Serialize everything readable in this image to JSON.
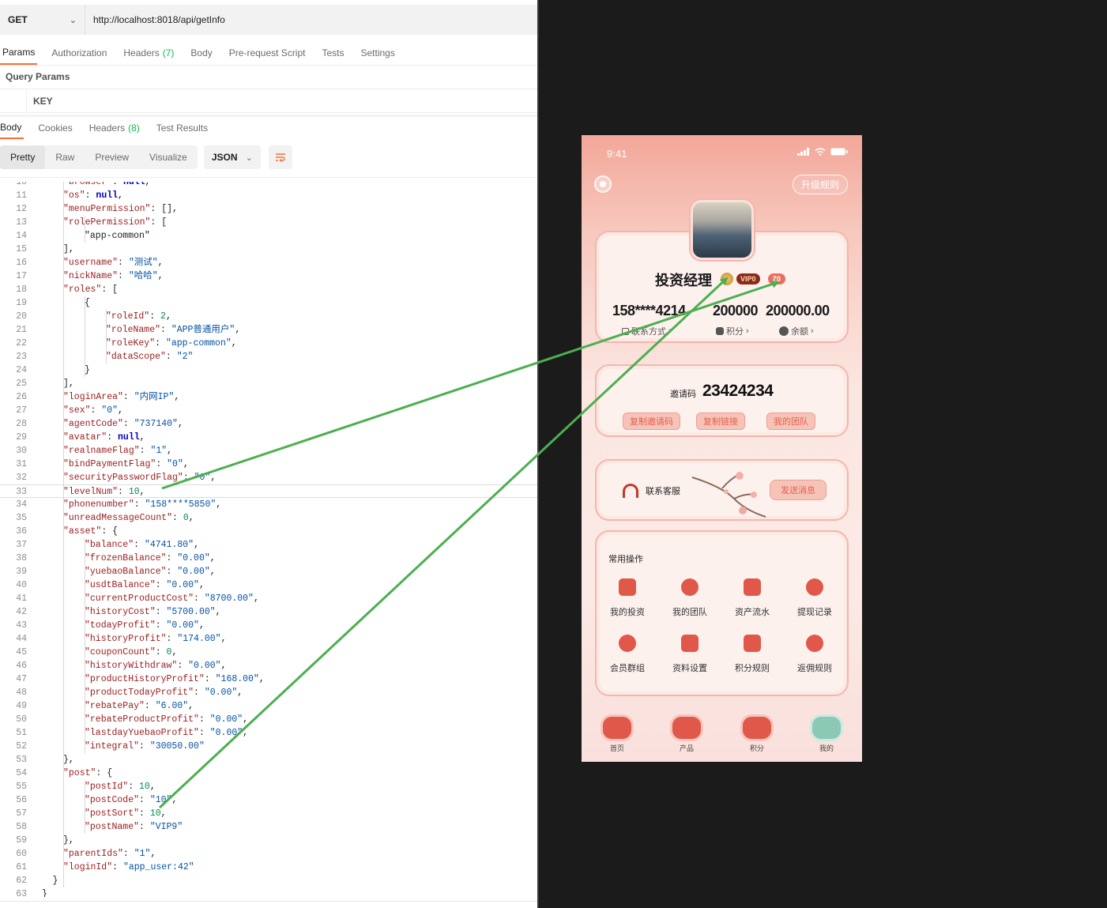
{
  "request": {
    "method": "GET",
    "url": "http://localhost:8018/api/getInfo",
    "tabs": [
      {
        "label": "Params",
        "active": true
      },
      {
        "label": "Authorization"
      },
      {
        "label": "Headers",
        "count": "(7)"
      },
      {
        "label": "Body"
      },
      {
        "label": "Pre-request Script"
      },
      {
        "label": "Tests"
      },
      {
        "label": "Settings"
      }
    ],
    "query_params_title": "Query Params",
    "key_header": "KEY"
  },
  "response": {
    "tabs": [
      {
        "label": "Body",
        "active": true
      },
      {
        "label": "Cookies"
      },
      {
        "label": "Headers",
        "count": "(8)"
      },
      {
        "label": "Test Results"
      }
    ],
    "formats": [
      "Pretty",
      "Raw",
      "Preview",
      "Visualize"
    ],
    "active_format": "Pretty",
    "language": "JSON"
  },
  "code_lines": [
    {
      "n": "10",
      "t": "\"browser\": null,",
      "i": 1,
      "cut": true
    },
    {
      "n": "11",
      "t": "\"os\": null,",
      "i": 1
    },
    {
      "n": "12",
      "t": "\"menuPermission\": [],",
      "i": 1
    },
    {
      "n": "13",
      "t": "\"rolePermission\": [",
      "i": 1
    },
    {
      "n": "14",
      "t": "\"app-common\"",
      "i": 2
    },
    {
      "n": "15",
      "t": "],",
      "i": 1
    },
    {
      "n": "16",
      "t": "\"username\": \"测试\",",
      "i": 1
    },
    {
      "n": "17",
      "t": "\"nickName\": \"哈哈\",",
      "i": 1
    },
    {
      "n": "18",
      "t": "\"roles\": [",
      "i": 1
    },
    {
      "n": "19",
      "t": "{",
      "i": 2
    },
    {
      "n": "20",
      "t": "\"roleId\": 2,",
      "i": 3
    },
    {
      "n": "21",
      "t": "\"roleName\": \"APP普通用户\",",
      "i": 3
    },
    {
      "n": "22",
      "t": "\"roleKey\": \"app-common\",",
      "i": 3
    },
    {
      "n": "23",
      "t": "\"dataScope\": \"2\"",
      "i": 3
    },
    {
      "n": "24",
      "t": "}",
      "i": 2
    },
    {
      "n": "25",
      "t": "],",
      "i": 1
    },
    {
      "n": "26",
      "t": "\"loginArea\": \"内网IP\",",
      "i": 1
    },
    {
      "n": "27",
      "t": "\"sex\": \"0\",",
      "i": 1
    },
    {
      "n": "28",
      "t": "\"agentCode\": \"737140\",",
      "i": 1
    },
    {
      "n": "29",
      "t": "\"avatar\": null,",
      "i": 1
    },
    {
      "n": "30",
      "t": "\"realnameFlag\": \"1\",",
      "i": 1
    },
    {
      "n": "31",
      "t": "\"bindPaymentFlag\": \"0\",",
      "i": 1
    },
    {
      "n": "32",
      "t": "\"securityPasswordFlag\": \"0\",",
      "i": 1
    },
    {
      "n": "33",
      "t": "\"levelNum\": 10,",
      "i": 1,
      "hl": true
    },
    {
      "n": "34",
      "t": "\"phonenumber\": \"158****5850\",",
      "i": 1
    },
    {
      "n": "35",
      "t": "\"unreadMessageCount\": 0,",
      "i": 1
    },
    {
      "n": "36",
      "t": "\"asset\": {",
      "i": 1
    },
    {
      "n": "37",
      "t": "\"balance\": \"4741.80\",",
      "i": 2
    },
    {
      "n": "38",
      "t": "\"frozenBalance\": \"0.00\",",
      "i": 2
    },
    {
      "n": "39",
      "t": "\"yuebaoBalance\": \"0.00\",",
      "i": 2
    },
    {
      "n": "40",
      "t": "\"usdtBalance\": \"0.00\",",
      "i": 2
    },
    {
      "n": "41",
      "t": "\"currentProductCost\": \"8700.00\",",
      "i": 2
    },
    {
      "n": "42",
      "t": "\"historyCost\": \"5700.00\",",
      "i": 2
    },
    {
      "n": "43",
      "t": "\"todayProfit\": \"0.00\",",
      "i": 2
    },
    {
      "n": "44",
      "t": "\"historyProfit\": \"174.00\",",
      "i": 2
    },
    {
      "n": "45",
      "t": "\"couponCount\": 0,",
      "i": 2
    },
    {
      "n": "46",
      "t": "\"historyWithdraw\": \"0.00\",",
      "i": 2
    },
    {
      "n": "47",
      "t": "\"productHistoryProfit\": \"168.00\",",
      "i": 2
    },
    {
      "n": "48",
      "t": "\"productTodayProfit\": \"0.00\",",
      "i": 2
    },
    {
      "n": "49",
      "t": "\"rebatePay\": \"6.00\",",
      "i": 2
    },
    {
      "n": "50",
      "t": "\"rebateProductProfit\": \"0.00\",",
      "i": 2
    },
    {
      "n": "51",
      "t": "\"lastdayYuebaoProfit\": \"0.00\",",
      "i": 2
    },
    {
      "n": "52",
      "t": "\"integral\": \"30050.00\"",
      "i": 2
    },
    {
      "n": "53",
      "t": "},",
      "i": 1
    },
    {
      "n": "54",
      "t": "\"post\": {",
      "i": 1
    },
    {
      "n": "55",
      "t": "\"postId\": 10,",
      "i": 2
    },
    {
      "n": "56",
      "t": "\"postCode\": \"10\",",
      "i": 2
    },
    {
      "n": "57",
      "t": "\"postSort\": 10,",
      "i": 2
    },
    {
      "n": "58",
      "t": "\"postName\": \"VIP9\"",
      "i": 2
    },
    {
      "n": "59",
      "t": "},",
      "i": 1
    },
    {
      "n": "60",
      "t": "\"parentIds\": \"1\",",
      "i": 1
    },
    {
      "n": "61",
      "t": "\"loginId\": \"app_user:42\"",
      "i": 1
    },
    {
      "n": "62",
      "t": "}",
      "i": 0.5
    },
    {
      "n": "63",
      "t": "}",
      "i": 0
    }
  ],
  "phone": {
    "time": "9:41",
    "upgrade_rules": "升级规则",
    "name": "投资经理",
    "vip_badge": "VIP0",
    "level_badge": "Z0",
    "phone_masked": "158****4214",
    "contact_label": "联系方式",
    "points_value": "200000",
    "points_label": "积分",
    "balance_value": "200000.00",
    "balance_label": "余额",
    "invite_label": "邀请码",
    "invite_code": "23424234",
    "copy_invite_code": "复制邀请码",
    "copy_link": "复制链接",
    "my_team": "我的团队",
    "service_label": "联系客服",
    "send_message": "发送消息",
    "ops_title": "常用操作",
    "ops": [
      {
        "label": "我的投资",
        "icon": "investment-icon"
      },
      {
        "label": "我的团队",
        "icon": "team-icon"
      },
      {
        "label": "资产流水",
        "icon": "ledger-icon"
      },
      {
        "label": "提现记录",
        "icon": "withdraw-icon"
      },
      {
        "label": "会员群组",
        "icon": "group-icon"
      },
      {
        "label": "资料设置",
        "icon": "profile-settings-icon"
      },
      {
        "label": "积分规则",
        "icon": "points-rules-icon"
      },
      {
        "label": "返佣规则",
        "icon": "percent-icon"
      }
    ],
    "tabbar": [
      {
        "label": "首页",
        "icon": "home-icon"
      },
      {
        "label": "产品",
        "icon": "product-icon"
      },
      {
        "label": "积分",
        "icon": "points-icon"
      },
      {
        "label": "我的",
        "icon": "user-icon"
      }
    ]
  },
  "colors": {
    "postman_accent": "#ff6c37",
    "phone_accent": "#e0584a",
    "annotation_arrow": "#4caf50",
    "dark_bg": "#1b1b1b"
  }
}
